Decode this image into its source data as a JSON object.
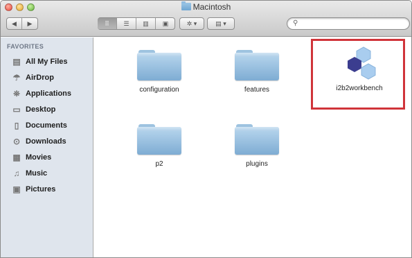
{
  "window": {
    "title": "Macintosh"
  },
  "toolbar": {
    "back_icon": "chevron-left",
    "forward_icon": "chevron-right",
    "view_modes": [
      "icon",
      "list",
      "column",
      "coverflow"
    ],
    "action_icon": "gear",
    "arrange_icon": "arrange",
    "search": {
      "value": "",
      "placeholder": ""
    }
  },
  "sidebar": {
    "heading": "FAVORITES",
    "items": [
      {
        "label": "All My Files",
        "icon": "all-files-icon"
      },
      {
        "label": "AirDrop",
        "icon": "airdrop-icon"
      },
      {
        "label": "Applications",
        "icon": "applications-icon"
      },
      {
        "label": "Desktop",
        "icon": "desktop-icon"
      },
      {
        "label": "Documents",
        "icon": "documents-icon"
      },
      {
        "label": "Downloads",
        "icon": "downloads-icon"
      },
      {
        "label": "Movies",
        "icon": "movies-icon"
      },
      {
        "label": "Music",
        "icon": "music-icon"
      },
      {
        "label": "Pictures",
        "icon": "pictures-icon"
      }
    ]
  },
  "content": {
    "items": [
      {
        "label": "configuration",
        "type": "folder"
      },
      {
        "label": "features",
        "type": "folder"
      },
      {
        "label": "i2b2workbench",
        "type": "application"
      },
      {
        "label": "p2",
        "type": "folder"
      },
      {
        "label": "plugins",
        "type": "folder"
      }
    ],
    "highlight_color": "#d0343a",
    "folder_color": "#8fb8dc"
  }
}
